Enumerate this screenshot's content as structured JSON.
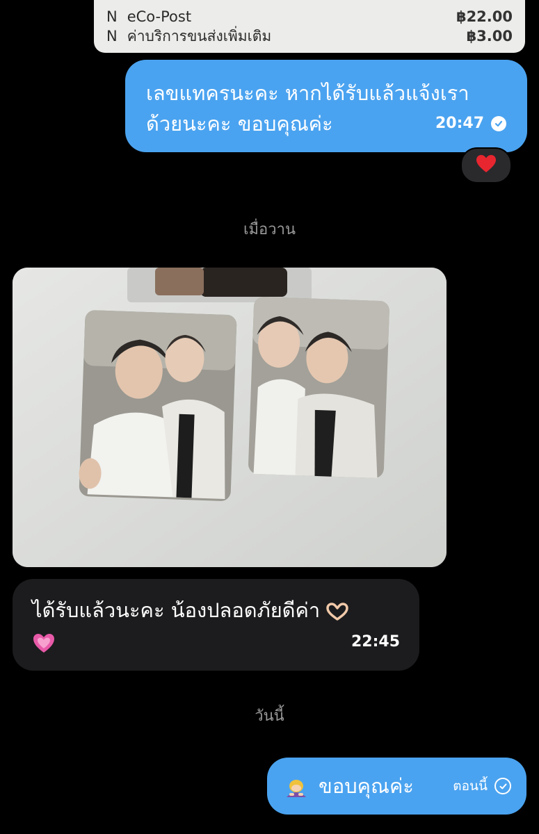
{
  "receipt": {
    "rows": [
      {
        "code": "N",
        "label": "eCo-Post",
        "amount": "฿22.00"
      },
      {
        "code": "N",
        "label": "ค่าบริการขนส่งเพิ่มเติม",
        "amount": "฿3.00"
      }
    ]
  },
  "messages": {
    "out1": {
      "line1": "เลขแทครนะคะ หากได้รับแล้วแจ้งเรา",
      "line2": "ด้วยนะคะ ขอบคุณค่ะ",
      "time": "20:47",
      "status_icon": "check-circle-filled",
      "reaction_icon": "red-heart"
    },
    "divider_yesterday": "เมื่อวาน",
    "photo": {
      "icon": "photocards-image"
    },
    "in1": {
      "line1": "ได้รับแล้วนะคะ น้องปลอดภัยดีค่า",
      "emoji1": "heart-hands",
      "emoji2": "pink-heart",
      "time": "22:45"
    },
    "divider_today": "วันนี้",
    "out2": {
      "emoji": "person-bowing",
      "text": "ขอบคุณค่ะ",
      "time": "ตอนนี้",
      "status_icon": "check-circle-outline"
    }
  },
  "colors": {
    "background": "#000000",
    "outgoing_bubble": "#4aa3f0",
    "incoming_bubble": "#1c1c1e",
    "divider_text": "#9a9a9a"
  }
}
